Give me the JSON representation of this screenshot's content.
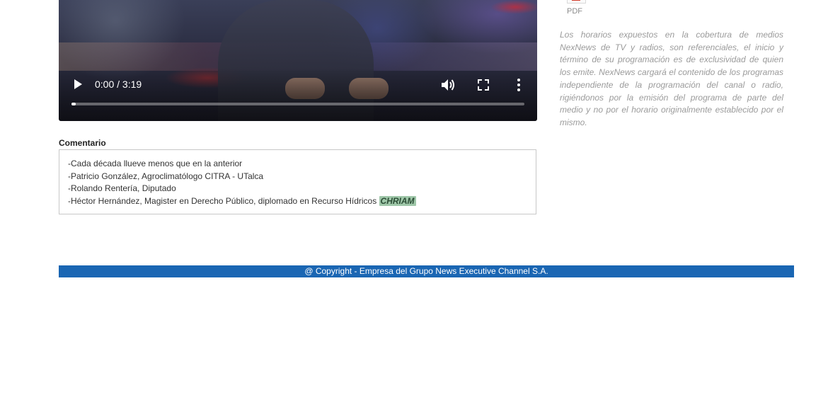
{
  "video": {
    "time_label": "0:00 / 3:19",
    "progress": 0
  },
  "sidebar": {
    "pdf_label": "PDF",
    "notice": "Los horarios expuestos en la cobertura de medios NexNews de TV y radios, son referenciales, el inicio y término de su programación es de exclusividad de quien los emite. NexNews cargará el contenido de los programas independiente de la programación del canal o radio, rigiéndonos por la emisión del programa de parte del medio y no por el horario originalmente establecido por el mismo."
  },
  "comment": {
    "title": "Comentario",
    "lines": [
      "-Cada década llueve menos que en la anterior",
      "-Patricio González, Agroclimatólogo CITRA - UTalca",
      "-Rolando Rentería, Diputado",
      "-Héctor Hernández, Magister en Derecho Público, diplomado en Recurso Hídricos "
    ],
    "tag": "CHRIAM"
  },
  "footer": {
    "copyright": "@ Copyright - Empresa del Grupo News Executive Channel S.A."
  },
  "colors": {
    "footer_bg": "#1a66b3",
    "tag_bg": "#9fc7a9",
    "notice_text": "#9b9b9b"
  }
}
